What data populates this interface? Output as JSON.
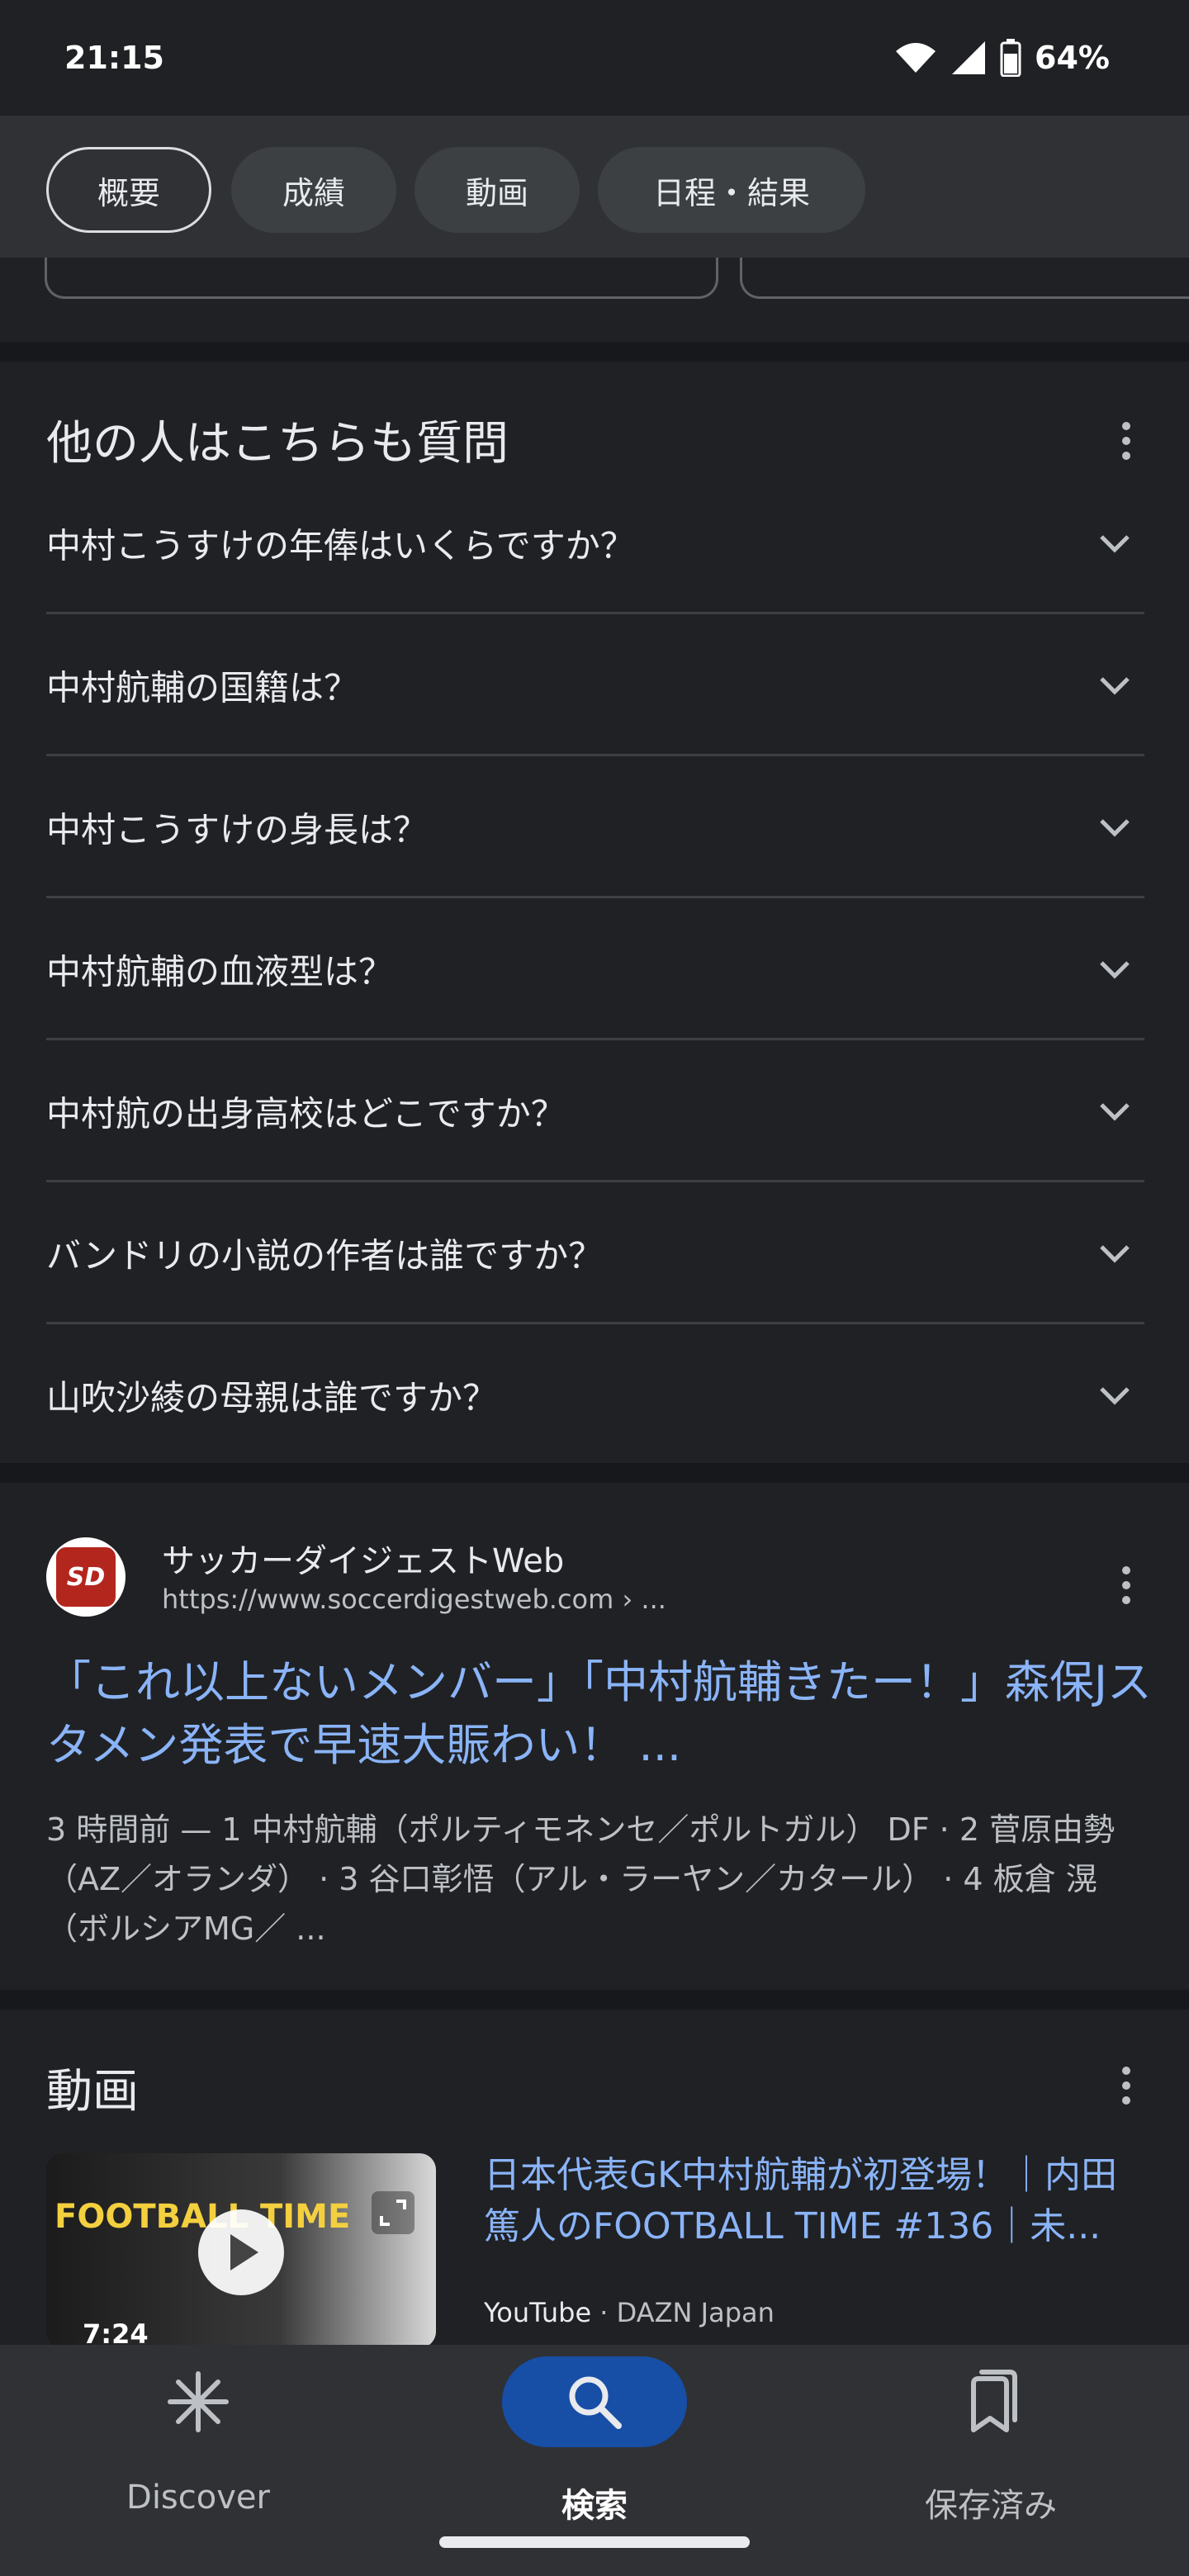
{
  "status_bar": {
    "time": "21:15",
    "battery": "64%"
  },
  "chips": [
    {
      "label": "概要",
      "selected": true
    },
    {
      "label": "成績",
      "selected": false
    },
    {
      "label": "動画",
      "selected": false
    },
    {
      "label": "日程・結果",
      "selected": false
    }
  ],
  "paa": {
    "title": "他の人はこちらも質問",
    "questions": [
      "中村こうすけの年俸はいくらですか？",
      "中村航輔の国籍は？",
      "中村こうすけの身長は？",
      "中村航輔の血液型は？",
      "中村航の出身高校はどこですか？",
      "バンドリの小説の作者は誰ですか？",
      "山吹沙綾の母親は誰ですか？"
    ]
  },
  "result": {
    "favicon_text": "SD",
    "site_name": "サッカーダイジェストWeb",
    "url": "https://www.soccerdigestweb.com › ...",
    "title": "「これ以上ないメンバー」「中村航輔きたー！」森保Jスタメン発表で早速大賑わい！ ...",
    "snippet": "3 時間前 — 1 中村航輔（ポルティモネンセ／ポルトガル） DF · 2 菅原由勢（AZ／オランダ） · 3 谷口彰悟（アル・ラーヤン／カタール） · 4 板倉 滉（ボルシアMG／ ..."
  },
  "videos": {
    "title": "動画",
    "item": {
      "thumb_text": "FOOTBALL TIME",
      "duration": "7:24",
      "title": "日本代表GK中村航輔が初登場！｜内田篤人のFOOTBALL TIME #136｜未...",
      "platform": "YouTube",
      "channel": "DAZN Japan"
    }
  },
  "bottom_nav": {
    "discover": "Discover",
    "search": "検索",
    "saved": "保存済み"
  }
}
